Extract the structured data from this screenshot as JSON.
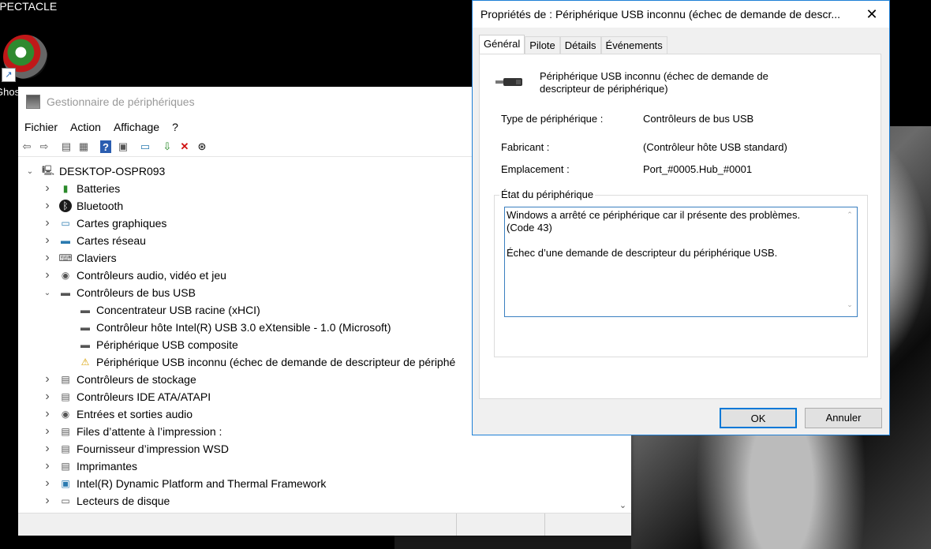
{
  "desktop": {
    "top_label": "SPECTACLE",
    "icon_label": "Ghos"
  },
  "device_manager": {
    "title": "Gestionnaire de périphériques",
    "menu": [
      "Fichier",
      "Action",
      "Affichage",
      "?"
    ],
    "tree": [
      {
        "label": "DESKTOP-OSPR093",
        "level": 0,
        "exp": "v",
        "icon": "computer-icon"
      },
      {
        "label": "Batteries",
        "level": 1,
        "exp": ">",
        "icon": "battery-icon"
      },
      {
        "label": "Bluetooth",
        "level": 1,
        "exp": ">",
        "icon": "bluetooth-icon"
      },
      {
        "label": "Cartes graphiques",
        "level": 1,
        "exp": ">",
        "icon": "display-adapter-icon"
      },
      {
        "label": "Cartes réseau",
        "level": 1,
        "exp": ">",
        "icon": "network-icon"
      },
      {
        "label": "Claviers",
        "level": 1,
        "exp": ">",
        "icon": "keyboard-icon"
      },
      {
        "label": "Contrôleurs audio, vidéo et jeu",
        "level": 1,
        "exp": ">",
        "icon": "speaker-icon"
      },
      {
        "label": "Contrôleurs de bus USB",
        "level": 1,
        "exp": "v",
        "icon": "usb-icon"
      },
      {
        "label": "Concentrateur USB racine (xHCI)",
        "level": 2,
        "exp": "",
        "icon": "usb-icon"
      },
      {
        "label": "Contrôleur hôte Intel(R) USB 3.0 eXtensible - 1.0 (Microsoft)",
        "level": 2,
        "exp": "",
        "icon": "usb-icon"
      },
      {
        "label": "Périphérique USB composite",
        "level": 2,
        "exp": "",
        "icon": "usb-icon"
      },
      {
        "label": "Périphérique USB inconnu (échec de demande de descripteur de périphé",
        "level": 2,
        "exp": "",
        "icon": "usb-warning-icon"
      },
      {
        "label": "Contrôleurs de stockage",
        "level": 1,
        "exp": ">",
        "icon": "storage-icon"
      },
      {
        "label": "Contrôleurs IDE ATA/ATAPI",
        "level": 1,
        "exp": ">",
        "icon": "ide-icon"
      },
      {
        "label": "Entrées et sorties audio",
        "level": 1,
        "exp": ">",
        "icon": "speaker-icon"
      },
      {
        "label": "Files d’attente à l’impression :",
        "level": 1,
        "exp": ">",
        "icon": "printer-icon"
      },
      {
        "label": "Fournisseur d’impression WSD",
        "level": 1,
        "exp": ">",
        "icon": "printer-icon"
      },
      {
        "label": "Imprimantes",
        "level": 1,
        "exp": ">",
        "icon": "printer-icon"
      },
      {
        "label": "Intel(R) Dynamic Platform and Thermal Framework",
        "level": 1,
        "exp": ">",
        "icon": "chip-icon"
      },
      {
        "label": "Lecteurs de disque",
        "level": 1,
        "exp": ">",
        "icon": "disk-icon"
      }
    ]
  },
  "dialog": {
    "title": "Propriétés de : Périphérique USB inconnu (échec de demande de descr...",
    "close": "✕",
    "tabs": [
      "Général",
      "Pilote",
      "Détails",
      "Événements"
    ],
    "device_name_line1": "Périphérique USB inconnu (échec de demande de",
    "device_name_line2": "descripteur de périphérique)",
    "type_label": "Type de périphérique :",
    "type_value": "Contrôleurs de bus USB",
    "manufacturer_label": "Fabricant :",
    "manufacturer_value": "(Contrôleur hôte USB standard)",
    "location_label": "Emplacement :",
    "location_value": "Port_#0005.Hub_#0001",
    "status_caption": "État du périphérique",
    "status_line1": "Windows a arrêté ce périphérique car il présente des problèmes.",
    "status_line2": "(Code 43)",
    "status_line3": "Échec d’une demande de descripteur du périphérique USB.",
    "ok": "OK",
    "cancel": "Annuler"
  }
}
